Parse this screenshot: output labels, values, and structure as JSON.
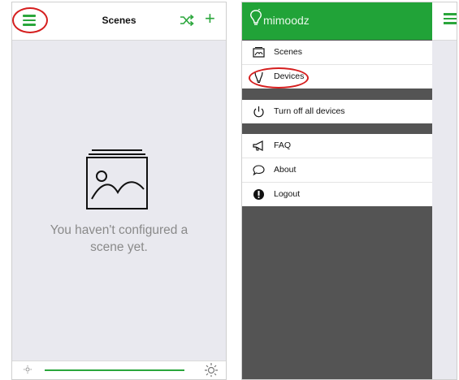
{
  "colors": {
    "accent": "#2aa63b",
    "drawer_header": "#21a338",
    "annotation": "#d51e1e",
    "empty_text": "#8a8a8a"
  },
  "left_screen": {
    "title": "Scenes",
    "icons": [
      "menu-icon",
      "shuffle-icon",
      "plus-icon",
      "photo-stack-icon",
      "sun-icon"
    ],
    "add_label": "+",
    "empty_message_line1": "You haven't configured a",
    "empty_message_line2": "scene yet."
  },
  "right_screen": {
    "app_name": "mimoodz",
    "menu_groups": [
      [
        {
          "label": "Scenes",
          "icon": "scenes-icon"
        },
        {
          "label": "Devices",
          "icon": "bulb-icon"
        }
      ],
      [
        {
          "label": "Turn off all devices",
          "icon": "power-icon"
        }
      ],
      [
        {
          "label": "FAQ",
          "icon": "megaphone-icon"
        },
        {
          "label": "About",
          "icon": "speech-bubble-icon"
        },
        {
          "label": "Logout",
          "icon": "logout-icon"
        }
      ]
    ]
  }
}
